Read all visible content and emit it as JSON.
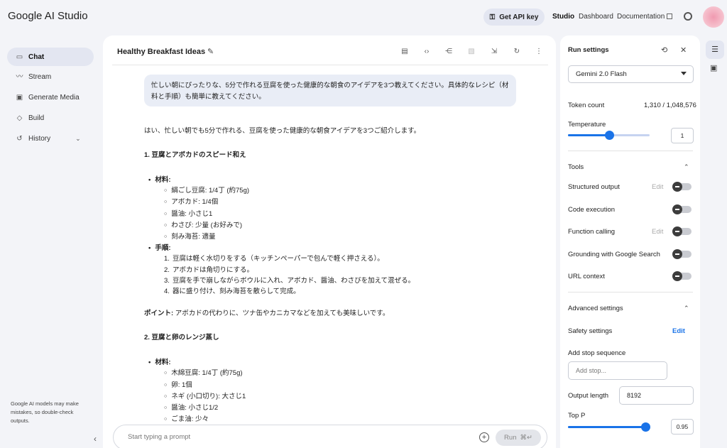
{
  "app": {
    "logo": "Google AI Studio"
  },
  "topbar": {
    "get_api_key": "Get API key",
    "nav": [
      {
        "label": "Studio"
      },
      {
        "label": "Dashboard"
      },
      {
        "label": "Documentation"
      }
    ]
  },
  "sidebar": {
    "items": [
      {
        "label": "Chat",
        "icon": "chat-icon"
      },
      {
        "label": "Stream",
        "icon": "stream-icon"
      },
      {
        "label": "Generate Media",
        "icon": "media-icon"
      },
      {
        "label": "Build",
        "icon": "build-icon"
      },
      {
        "label": "History",
        "icon": "history-icon"
      }
    ],
    "note": "Google AI models may make mistakes, so double-check outputs."
  },
  "chat": {
    "title": "Healthy Breakfast Ideas",
    "user_message": "忙しい朝にぴったりな、5分で作れる豆腐を使った健康的な朝食のアイデアを3つ教えてください。具体的なレシピ（材料と手順）も簡単に教えてください。",
    "response": {
      "intro": "はい、忙しい朝でも5分で作れる、豆腐を使った健康的な朝食アイデアを3つご紹介します。",
      "recipe1": {
        "heading": "1. 豆腐とアボカドのスピード和え",
        "ingredients_label": "材料:",
        "ingredients": [
          "絹ごし豆腐: 1/4丁 (約75g)",
          "アボカド: 1/4個",
          "醤油: 小さじ1",
          "わさび: 少量 (お好みで)",
          "刻み海苔: 適量"
        ],
        "steps_label": "手順:",
        "steps": [
          "豆腐は軽く水切りをする（キッチンペーパーで包んで軽く押さえる）。",
          "アボカドは角切りにする。",
          "豆腐を手で崩しながらボウルに入れ、アボカド、醤油、わさびを加えて混ぜる。",
          "器に盛り付け、刻み海苔を散らして完成。"
        ],
        "point_label": "ポイント:",
        "point_text": " アボカドの代わりに、ツナ缶やカニカマなどを加えても美味しいです。"
      },
      "recipe2": {
        "heading": "2. 豆腐と卵のレンジ蒸し",
        "ingredients_label": "材料:",
        "ingredients": [
          "木綿豆腐: 1/4丁 (約75g)",
          "卵: 1個",
          "ネギ (小口切り): 大さじ1",
          "醤油: 小さじ1/2",
          "ごま油: 少々"
        ]
      }
    }
  },
  "prompt": {
    "placeholder": "Start typing a prompt",
    "run_label": "Run",
    "shortcut": "⌘↵"
  },
  "run_settings": {
    "title": "Run settings",
    "model": "Gemini 2.0 Flash",
    "token_count_label": "Token count",
    "token_count": "1,310 / 1,048,576",
    "temperature_label": "Temperature",
    "temperature": "1",
    "temperature_fraction": 0.5,
    "tools_label": "Tools",
    "tools": [
      {
        "label": "Structured output",
        "edit": "Edit"
      },
      {
        "label": "Code execution",
        "edit": ""
      },
      {
        "label": "Function calling",
        "edit": "Edit"
      },
      {
        "label": "Grounding with Google Search",
        "edit": ""
      },
      {
        "label": "URL context",
        "edit": ""
      }
    ],
    "advanced_label": "Advanced settings",
    "safety_label": "Safety settings",
    "safety_edit": "Edit",
    "stop_label": "Add stop sequence",
    "stop_placeholder": "Add stop...",
    "output_length_label": "Output length",
    "output_length": "8192",
    "top_p_label": "Top P",
    "top_p": "0.95",
    "top_p_fraction": 0.95
  }
}
